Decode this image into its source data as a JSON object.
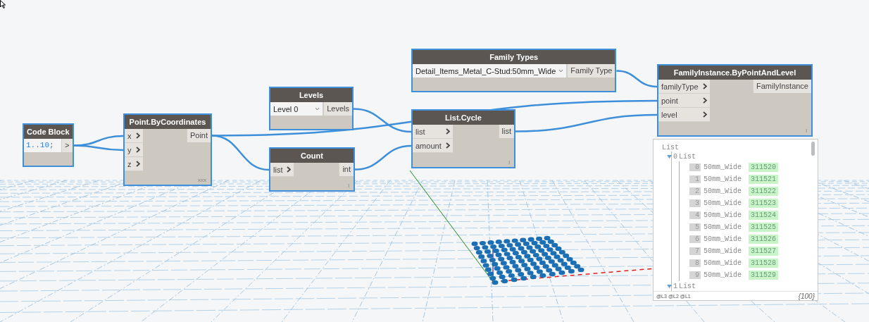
{
  "nodes": [
    {
      "kind": "code",
      "title": "Code Block",
      "code": "1..10;",
      "outputs": [
        ">"
      ],
      "selected": true
    },
    {
      "kind": "function",
      "title": "Point.ByCoordinates",
      "inputs": [
        "x",
        "y",
        "z"
      ],
      "outputs": [
        "Point"
      ],
      "lacing": "xxx",
      "selected": true
    },
    {
      "kind": "selector",
      "title": "Levels",
      "value": "Level 0",
      "outputs": [
        "Levels"
      ],
      "selected": true
    },
    {
      "kind": "function",
      "title": "Count",
      "inputs": [
        "list"
      ],
      "outputs": [
        "int"
      ],
      "lacing": "l",
      "selected": true
    },
    {
      "kind": "selector",
      "title": "Family Types",
      "value": "Detail_Items_Metal_C-Stud:50mm_Wide",
      "outputs": [
        "Family Type"
      ],
      "selected": true
    },
    {
      "kind": "function",
      "title": "List.Cycle",
      "inputs": [
        "list",
        "amount"
      ],
      "outputs": [
        "list"
      ],
      "lacing": "l",
      "selected": true
    },
    {
      "kind": "function",
      "title": "FamilyInstance.ByPointAndLevel",
      "inputs": [
        "familyType",
        "point",
        "level"
      ],
      "outputs": [
        "FamilyInstance"
      ],
      "lacing": "l",
      "selected": true
    }
  ],
  "watch": {
    "title": "List",
    "groups": [
      {
        "index": "0",
        "label": "List",
        "items": [
          {
            "index": "0",
            "name": "50mm_Wide",
            "value": "311520"
          },
          {
            "index": "1",
            "name": "50mm_Wide",
            "value": "311521"
          },
          {
            "index": "2",
            "name": "50mm_Wide",
            "value": "311522"
          },
          {
            "index": "3",
            "name": "50mm_Wide",
            "value": "311523"
          },
          {
            "index": "4",
            "name": "50mm_Wide",
            "value": "311524"
          },
          {
            "index": "5",
            "name": "50mm_Wide",
            "value": "311525"
          },
          {
            "index": "6",
            "name": "50mm_Wide",
            "value": "311526"
          },
          {
            "index": "7",
            "name": "50mm_Wide",
            "value": "311527"
          },
          {
            "index": "8",
            "name": "50mm_Wide",
            "value": "311528"
          },
          {
            "index": "9",
            "name": "50mm_Wide",
            "value": "311529"
          }
        ]
      },
      {
        "index": "1",
        "label": "List"
      }
    ],
    "levels": [
      "@L3",
      "@L2",
      "@L1"
    ],
    "count": "{100}"
  }
}
